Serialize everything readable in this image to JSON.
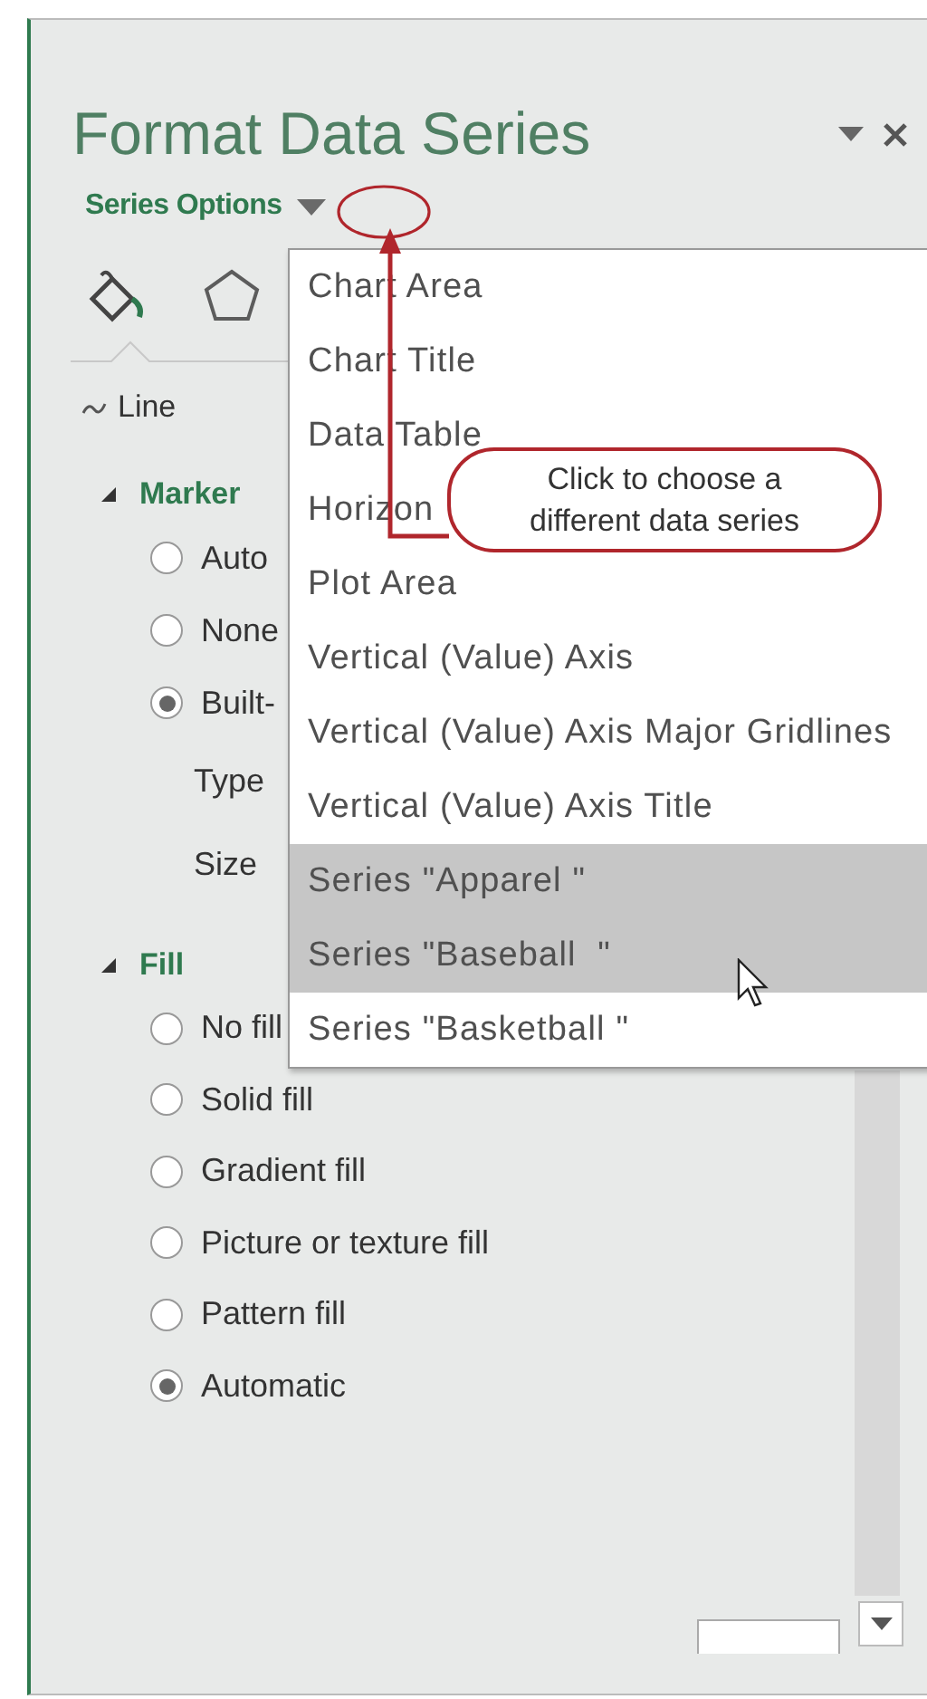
{
  "panel": {
    "title": "Format Data Series",
    "options_label": "Series Options",
    "tabs": [
      {
        "kind": "fill",
        "selected": true
      },
      {
        "kind": "shape",
        "selected": false
      }
    ],
    "subtab": "Line",
    "sections": [
      {
        "title": "Marker",
        "expanded": true,
        "items": [
          {
            "kind": "radio",
            "label": "Auto",
            "selected": false
          },
          {
            "kind": "radio",
            "label": "None",
            "selected": false
          },
          {
            "kind": "radio",
            "label": "Built-",
            "selected": true
          },
          {
            "kind": "field",
            "label": "Type"
          },
          {
            "kind": "field",
            "label": "Size"
          }
        ]
      },
      {
        "title": "Fill",
        "expanded": true,
        "items": [
          {
            "kind": "radio",
            "label": "No fill",
            "selected": false
          },
          {
            "kind": "radio",
            "label": "Solid fill",
            "selected": false
          },
          {
            "kind": "radio",
            "label": "Gradient fill",
            "selected": false
          },
          {
            "kind": "radio",
            "label": "Picture or texture fill",
            "selected": false
          },
          {
            "kind": "radio",
            "label": "Pattern fill",
            "selected": false
          },
          {
            "kind": "radio",
            "label": "Automatic",
            "selected": true
          }
        ]
      }
    ]
  },
  "menu": {
    "items": [
      {
        "label": "Chart Area",
        "highlighted": false
      },
      {
        "label": "Chart Title",
        "highlighted": false
      },
      {
        "label": "Data Table",
        "highlighted": false
      },
      {
        "label": "Horizon",
        "highlighted": false
      },
      {
        "label": "Plot Area",
        "highlighted": false
      },
      {
        "label": "Vertical (Value) Axis",
        "highlighted": false
      },
      {
        "label": "Vertical (Value) Axis Major Gridlines",
        "highlighted": false
      },
      {
        "label": "Vertical (Value) Axis Title",
        "highlighted": false
      },
      {
        "label": "Series \"Apparel \"",
        "highlighted": true
      },
      {
        "label": "Series \"Baseball  \"",
        "highlighted": true
      },
      {
        "label": "Series \"Basketball \"",
        "highlighted": false
      }
    ]
  },
  "callout": {
    "text": "Click to choose a different data series"
  }
}
